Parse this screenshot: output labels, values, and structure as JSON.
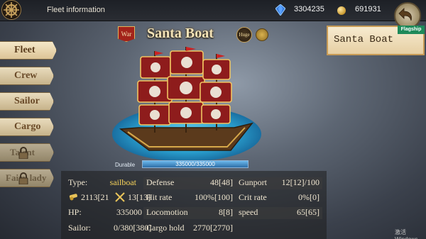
{
  "header": {
    "title": "Fleet information",
    "gems": "3304235",
    "gold": "691931"
  },
  "sidebar": {
    "items": [
      {
        "label": "Fleet",
        "active": true,
        "locked": false
      },
      {
        "label": "Crew",
        "active": false,
        "locked": false
      },
      {
        "label": "Sailor",
        "active": false,
        "locked": false
      },
      {
        "label": "Cargo",
        "active": false,
        "locked": false
      },
      {
        "label": "Talent",
        "active": false,
        "locked": true
      },
      {
        "label": "Fairy lady",
        "active": false,
        "locked": true
      }
    ]
  },
  "ship": {
    "war_badge": "War",
    "name": "Santa Boat",
    "size_badge": "Huge",
    "durable_label": "Durable",
    "durable_value": "335000/335000",
    "durable_fraction": 1.0
  },
  "flagship_card": {
    "name": "Santa Boat",
    "tag": "Flagship"
  },
  "stats": {
    "type_label": "Type:",
    "type_value": "sailboat",
    "cannon_value": "2113[21",
    "sword_value": "13[13]",
    "hp_label": "HP:",
    "hp_value": "335000",
    "sailor_label": "Sailor:",
    "sailor_value": "0/380[380]",
    "defense_label": "Defense",
    "defense_value": "48[48]",
    "hit_label": "Hit rate",
    "hit_value": "100%[100]",
    "locomotion_label": "Locomotion",
    "locomotion_value": "8[8]",
    "cargo_label": "Cargo hold",
    "cargo_value": "2770[2770]",
    "gunport_label": "Gunport",
    "gunport_value": "12[12]/100",
    "crit_label": "Crit rate",
    "crit_value": "0%[0]",
    "speed_label": "speed",
    "speed_value": "65[65]"
  },
  "watermark": "激活 Windows",
  "colors": {
    "accent_gold": "#f4e4b8",
    "type_value": "#f7d35a",
    "war_red": "#a3231a",
    "flagship_green": "#1e8a5a",
    "durable_blue": "#4f95cc"
  }
}
